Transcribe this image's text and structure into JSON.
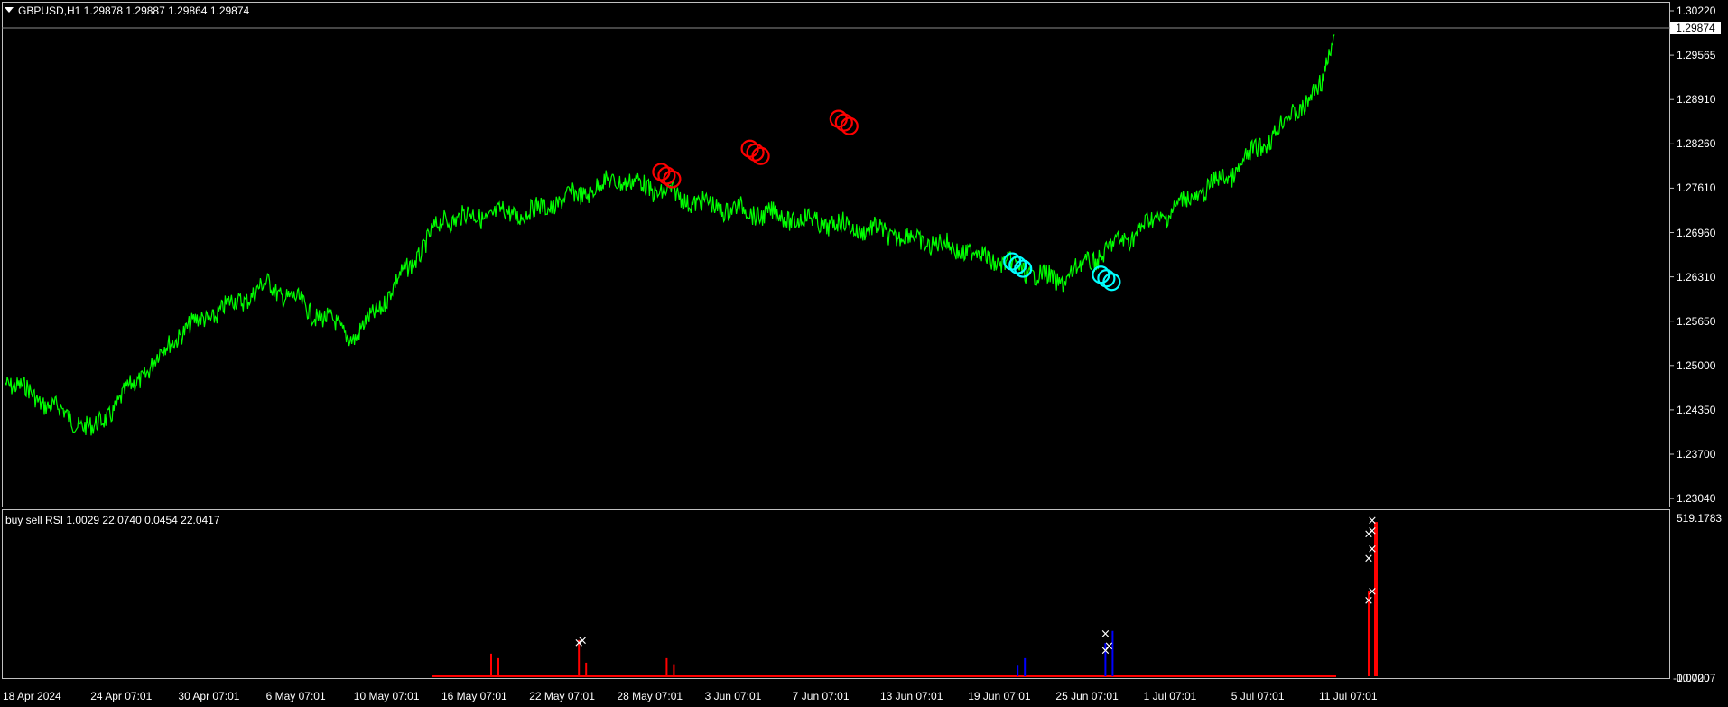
{
  "main_chart": {
    "header": "GBPUSD,H1  1.29878 1.29887 1.29864 1.29874",
    "current_price": "1.29874",
    "price_ticks": [
      "1.30220",
      "1.29565",
      "1.28910",
      "1.28260",
      "1.27610",
      "1.26960",
      "1.26310",
      "1.25650",
      "1.25000",
      "1.24350",
      "1.23700",
      "1.23040"
    ],
    "line_color": "#00ff00",
    "sell_marker_color": "#ff0000",
    "buy_marker_color": "#00ffff"
  },
  "sub_chart": {
    "header": "buy sell RSI 1.0029 22.0740 0.0454 22.0417",
    "top_tick": "519.1783",
    "bottom_tick": "0.0000",
    "bottom_tick_overlap": "-10.7207",
    "sell_color": "#ff0000",
    "buy_color": "#0000ff"
  },
  "time_ticks": [
    "18 Apr 2024",
    "24 Apr 07:01",
    "30 Apr 07:01",
    "6 May 07:01",
    "10 May 07:01",
    "16 May 07:01",
    "22 May 07:01",
    "28 May 07:01",
    "3 Jun 07:01",
    "7 Jun 07:01",
    "13 Jun 07:01",
    "19 Jun 07:01",
    "25 Jun 07:01",
    "1 Jul 07:01",
    "5 Jul 07:01",
    "11 Jul 07:01"
  ],
  "chart_data": {
    "type": "line",
    "x": [
      "18 Apr 2024",
      "24 Apr 07:01",
      "30 Apr 07:01",
      "6 May 07:01",
      "10 May 07:01",
      "16 May 07:01",
      "22 May 07:01",
      "28 May 07:01",
      "3 Jun 07:01",
      "7 Jun 07:01",
      "13 Jun 07:01",
      "19 Jun 07:01",
      "25 Jun 07:01",
      "1 Jul 07:01",
      "5 Jul 07:01",
      "11 Jul 07:01"
    ],
    "series": [
      {
        "values": [
          1.2468,
          1.239,
          1.254,
          1.261,
          1.253,
          1.271,
          1.272,
          1.277,
          1.273,
          1.271,
          1.269,
          1.266,
          1.2615,
          1.27,
          1.278,
          1.291
        ]
      }
    ],
    "last_value": 1.29874,
    "ylim": [
      1.228,
      1.3022
    ],
    "sell_signals": [
      {
        "x": "28 May 07:01",
        "y": 1.2775
      },
      {
        "x": "3 Jun 07:01",
        "y": 1.281
      },
      {
        "x": "7 Jun 07:01",
        "y": 1.2855
      }
    ],
    "buy_signals": [
      {
        "x": "19 Jun 07:01",
        "y": 1.264
      },
      {
        "x": "25 Jun 07:01",
        "y": 1.262
      }
    ],
    "rsi_histogram": {
      "ylim": [
        0,
        519.1783
      ],
      "sell_bars": [
        {
          "x": "16 May 07:01",
          "value": 75
        },
        {
          "x": "16 May 07:01",
          "value": 60
        },
        {
          "x": "22 May 07:01",
          "value": 120
        },
        {
          "x": "22 May 07:01",
          "value": 45
        },
        {
          "x": "28 May 07:01",
          "value": 60
        },
        {
          "x": "28 May 07:01",
          "value": 40
        },
        {
          "x": "11 Jul 07:01",
          "value": 280
        },
        {
          "x": "11 Jul 07:01",
          "value": 510
        }
      ],
      "buy_bars": [
        {
          "x": "19 Jun 07:01",
          "value": 35
        },
        {
          "x": "19 Jun 07:01",
          "value": 60
        },
        {
          "x": "25 Jun 07:01",
          "value": 110
        },
        {
          "x": "25 Jun 07:01",
          "value": 150
        }
      ],
      "cross_markers": [
        {
          "x": "22 May 07:01",
          "value": 110
        },
        {
          "x": "22 May 07:01",
          "value": 118
        },
        {
          "x": "25 Jun 07:01",
          "value": 85
        },
        {
          "x": "25 Jun 07:01",
          "value": 100
        },
        {
          "x": "25 Jun 07:01",
          "value": 140
        },
        {
          "x": "11 Jul 07:01",
          "value": 280
        },
        {
          "x": "11 Jul 07:01",
          "value": 250
        },
        {
          "x": "11 Jul 07:01",
          "value": 480
        },
        {
          "x": "11 Jul 07:01",
          "value": 470
        },
        {
          "x": "11 Jul 07:01",
          "value": 420
        },
        {
          "x": "11 Jul 07:01",
          "value": 390
        },
        {
          "x": "11 Jul 07:01",
          "value": 515
        }
      ]
    }
  }
}
